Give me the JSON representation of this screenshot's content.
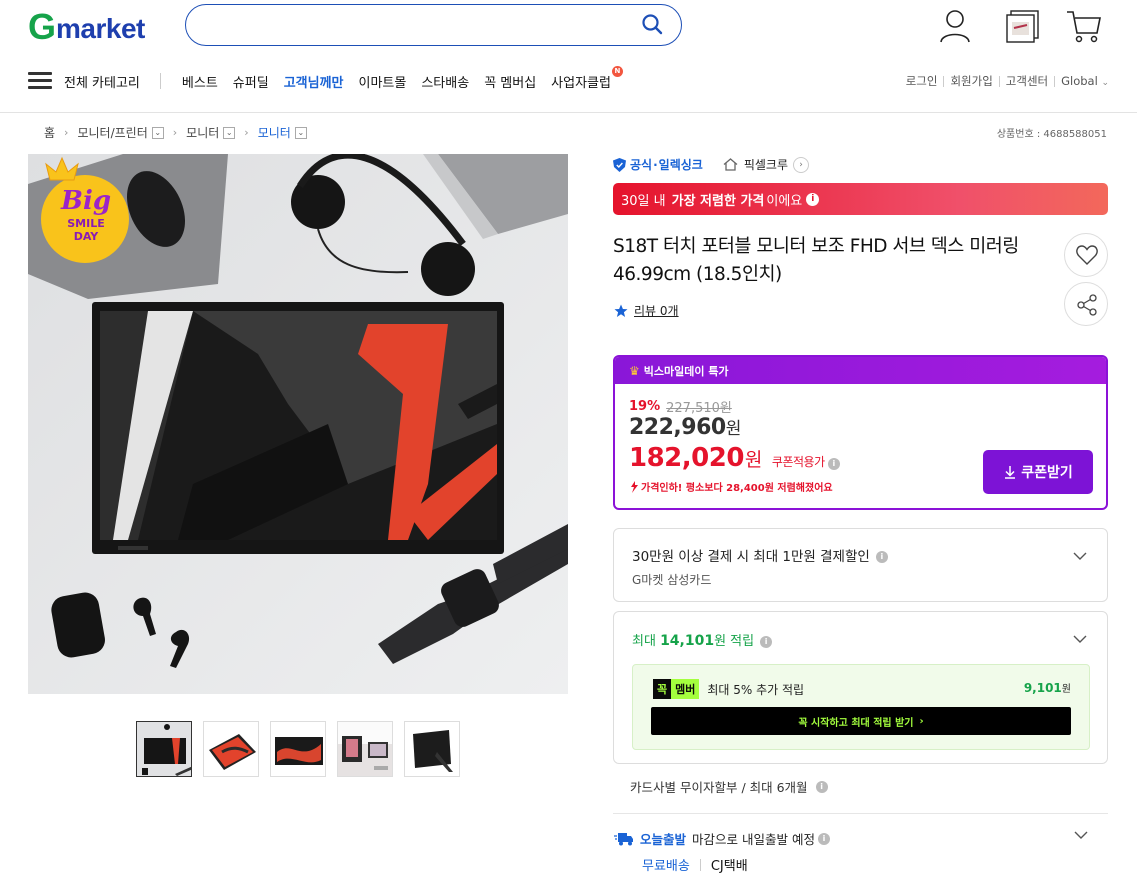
{
  "header": {
    "logo_g": "G",
    "logo_rest": "market",
    "search": {
      "value": "",
      "placeholder": ""
    },
    "nav": {
      "all_categories": "전체 카테고리",
      "items": [
        {
          "label": "베스트",
          "highlight": false
        },
        {
          "label": "슈퍼딜",
          "highlight": false
        },
        {
          "label": "고객님께만",
          "highlight": true
        },
        {
          "label": "이마트몰",
          "highlight": false
        },
        {
          "label": "스타배송",
          "highlight": false
        },
        {
          "label": "꼭 멤버십",
          "highlight": false
        },
        {
          "label": "사업자클럽",
          "highlight": false,
          "badge": "N"
        }
      ]
    },
    "util": {
      "login": "로그인",
      "signup": "회원가입",
      "support": "고객센터",
      "global": "Global"
    }
  },
  "breadcrumb": {
    "home": "홈",
    "items": [
      {
        "label": "모니터/프린터",
        "current": false
      },
      {
        "label": "모니터",
        "current": false
      },
      {
        "label": "모니터",
        "current": true
      }
    ],
    "product_number": "상품번호 : 4688588051"
  },
  "gallery": {
    "badge": {
      "line1": "Big",
      "line2": "SMILE",
      "line3": "DAY"
    },
    "thumbnail_count": 5,
    "selected_index": 0
  },
  "product": {
    "official": "공식",
    "seller": "일렉싱크",
    "shop": "픽셀크루",
    "lowest_notice": {
      "pre": "30일 내",
      "bold": "가장 저렴한 가격",
      "post": "이에요"
    },
    "title": "S18T 터치 포터블 모니터 보조 FHD 서브 덱스 미러링 46.99cm (18.5인치)",
    "review": "리뷰 0개"
  },
  "price": {
    "event_label": "빅스마일데이 특가",
    "discount": "19%",
    "original": "227,510원",
    "price": "222,960",
    "coupon_price": "182,020",
    "won": "원",
    "coupon_applied_label": "쿠폰적용가",
    "price_drop": "가격인하! 평소보다 28,400원 저렴해졌어요",
    "coupon_button": "쿠폰받기"
  },
  "card_benefit": {
    "title": "30만원 이상 결제 시 최대 1만원 결제할인",
    "sub": "G마켓 삼성카드"
  },
  "points": {
    "pre": "최대",
    "amount": "14,101",
    "post": "원 적립",
    "member_badge_1": "꼭",
    "member_badge_2": "멤버",
    "member_text": "최대 5% 추가 적립",
    "member_amount": "9,101",
    "member_won": "원",
    "member_button": "꼭 시작하고 최대 적립 받기"
  },
  "installment": "카드사별 무이자할부 / 최대 6개월",
  "shipping": {
    "today": "오늘출발",
    "message": "마감으로 내일출발 예정",
    "free": "무료배송",
    "carrier": "CJ택배"
  },
  "colors": {
    "brand_green": "#16a34a",
    "brand_blue": "#1e3fae",
    "accent_red": "#e5132c",
    "accent_purple": "#8b12d7",
    "member_lime": "#a4ff3e"
  }
}
